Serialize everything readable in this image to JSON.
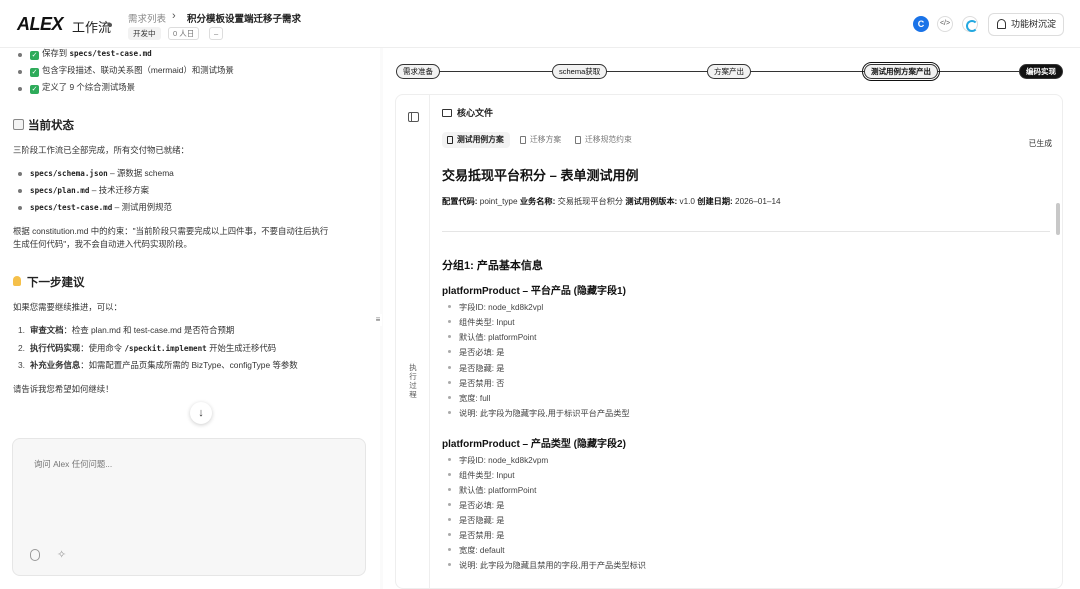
{
  "header": {
    "logo": "ALEX",
    "workspace": "工作流",
    "breadcrumb_parent": "需求列表",
    "breadcrumb_sep": "›",
    "breadcrumb_current": "积分模板设置端迁移子需求",
    "status_tag": "开发中",
    "people_tag": "0 人日",
    "more_tag": "–",
    "feature_button": "功能树沉淀",
    "icon_c": "C",
    "icon_code": "</>"
  },
  "chat": {
    "checklist": [
      {
        "pre": "保存到 ",
        "code": "specs/test-case.md",
        "post": ""
      },
      {
        "pre": "包含字段描述、联动关系图（mermaid）和测试场景",
        "code": "",
        "post": ""
      },
      {
        "pre": "定义了 9 个综合测试场景",
        "code": "",
        "post": ""
      }
    ],
    "status_heading": "当前状态",
    "status_text": "三阶段工作流已全部完成，所有交付物已就绪：",
    "deliverables": [
      {
        "code": "specs/schema.json",
        "desc": " – 源数据 schema"
      },
      {
        "code": "specs/plan.md",
        "desc": " – 技术迁移方案"
      },
      {
        "code": "specs/test-case.md",
        "desc": " – 测试用例规范"
      }
    ],
    "constraint_line1": "根据 constitution.md 中的约束：\"当前阶段只需要完成以上四件事，不要自动往后执行",
    "constraint_line2": "生成任何代码\"，我不会自动进入代码实现阶段。",
    "next_heading": "下一步建议",
    "next_intro": "如果您需要继续推进，可以：",
    "suggestions": [
      {
        "n": "1.",
        "bold": "审查文档",
        "pre": "：检查 plan.md 和 test-case.md 是否符合预期",
        "code": "",
        "post": ""
      },
      {
        "n": "2.",
        "bold": "执行代码实现",
        "pre": "：使用命令 ",
        "code": "/speckit.implement",
        "post": " 开始生成迁移代码"
      },
      {
        "n": "3.",
        "bold": "补充业务信息",
        "pre": "：如需配置产品页集成所需的 BizType、configType 等参数",
        "code": "",
        "post": ""
      }
    ],
    "closing": "请告诉我您希望如何继续！",
    "input_placeholder": "询问 Alex 任何问题..."
  },
  "workflow": {
    "steps": [
      "需求准备",
      "schema获取",
      "方案产出",
      "测试用例方案产出",
      "编码实现"
    ],
    "active_step": "测试用例方案产出"
  },
  "doc_panel": {
    "title": "核心文件",
    "side_label": "执行过程",
    "tabs": [
      "测试用例方案",
      "迁移方案",
      "迁移规范约束"
    ],
    "active_tab": "测试用例方案",
    "generated_label": "已生成",
    "doc_title": "交易抵现平台积分 – 表单测试用例",
    "meta": {
      "k1": "配置代码:",
      "v1": " point_type ",
      "k2": "业务名称:",
      "v2": " 交易抵现平台积分 ",
      "k3": "测试用例版本:",
      "v3": " v1.0 ",
      "k4": "创建日期:",
      "v4": " 2026–01–14"
    },
    "group_heading": "分组1: 产品基本信息",
    "fields": [
      {
        "title": "platformProduct – 平台产品 (隐藏字段1)",
        "items": [
          "字段ID: node_kd8k2vpl",
          "组件类型: Input",
          "默认值: platformPoint",
          "是否必填: 是",
          "是否隐藏: 是",
          "是否禁用: 否",
          "宽度: full",
          "说明: 此字段为隐藏字段,用于标识平台产品类型"
        ]
      },
      {
        "title": "platformProduct – 产品类型 (隐藏字段2)",
        "items": [
          "字段ID: node_kd8k2vpm",
          "组件类型: Input",
          "默认值: platformPoint",
          "是否必填: 是",
          "是否隐藏: 是",
          "是否禁用: 是",
          "宽度: default",
          "说明: 此字段为隐藏且禁用的字段,用于产品类型标识"
        ]
      }
    ]
  }
}
